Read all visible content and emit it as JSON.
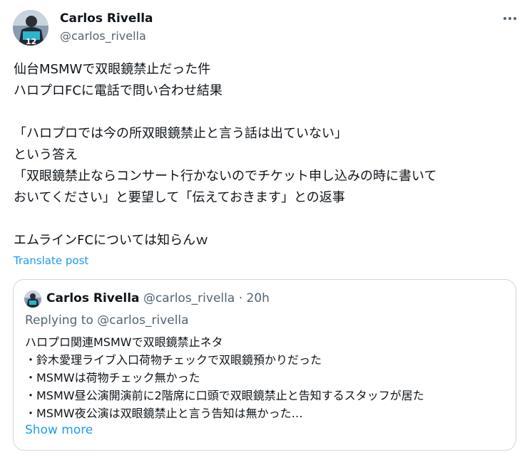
{
  "tweet": {
    "author_name": "Carlos Rivella",
    "author_handle": "@carlos_rivella",
    "more_icon": "more-horizontal-icon",
    "text": "仙台MSMWで双眼鏡禁止だった件\nハロプロFCに電話で問い合わせ結果\n\n「ハロプロでは今の所双眼鏡禁止と言う話は出ていない」\nという答え\n「双眼鏡禁止ならコンサート行かないのでチケット申し込みの時に書いて\nおいてください」と要望して「伝えておきます」との返事\n\nエムラインFCについては知らんｗ",
    "translate_label": "Translate post",
    "colors": {
      "link": "#1d9bf0",
      "secondary": "#536471",
      "border": "#cfd9de"
    }
  },
  "quote": {
    "author_name": "Carlos Rivella",
    "author_handle": "@carlos_rivella",
    "separator": "·",
    "time": "20h",
    "replying_to": "Replying to @carlos_rivella",
    "lines": [
      "ハロプロ関連MSMWで双眼鏡禁止ネタ",
      "・鈴木愛理ライブ入口荷物チェックで双眼鏡預かりだった",
      "・MSMWは荷物チェック無かった",
      "・MSMW昼公演開演前に2階席に口頭で双眼鏡禁止と告知するスタッフが居た",
      "・MSMW夜公演は双眼鏡禁止と言う告知は無かった…"
    ],
    "show_more_label": "Show more"
  }
}
